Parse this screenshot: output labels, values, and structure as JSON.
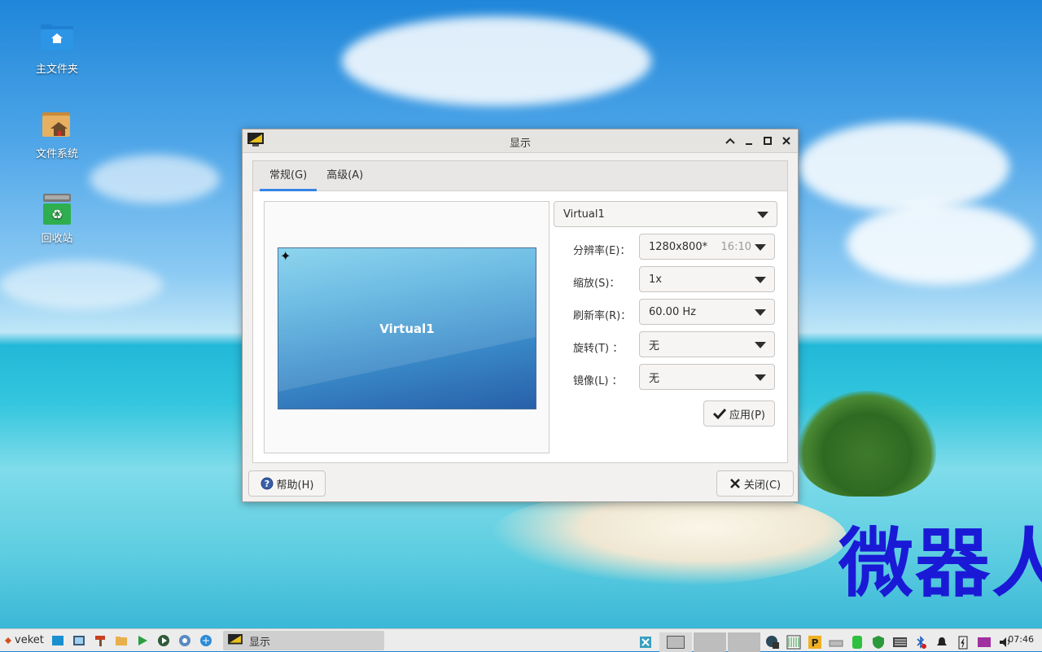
{
  "desktop": {
    "icons": [
      {
        "label": "主文件夹"
      },
      {
        "label": "文件系统"
      },
      {
        "label": "回收站"
      }
    ],
    "watermark": "微器人"
  },
  "window": {
    "title": "显示",
    "tabs": [
      {
        "label": "常规(G)"
      },
      {
        "label": "高级(A)"
      }
    ],
    "preview": {
      "monitor_name": "Virtual1"
    },
    "output_select": {
      "value": "Virtual1"
    },
    "settings": [
      {
        "label": "分辨率(E)：",
        "value": "1280x800*",
        "extra": "16:10"
      },
      {
        "label": "缩放(S)：",
        "value": "1x"
      },
      {
        "label": "刷新率(R)：",
        "value": "60.00 Hz"
      },
      {
        "label": "旋转(T) ：",
        "value": "无"
      },
      {
        "label": "镜像(L) ：",
        "value": "无"
      }
    ],
    "apply_label": "应用(P)",
    "help_label": "帮助(H)",
    "close_label": "关闭(C)"
  },
  "taskbar": {
    "menu_label": "veket",
    "task_label": "显示",
    "clock": "07:46"
  },
  "colors": {
    "accent": "#3584e4",
    "watermark": "#1a1ad6"
  }
}
